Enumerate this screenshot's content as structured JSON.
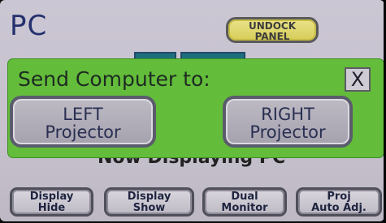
{
  "header": {
    "title": "PC",
    "undock_label": "UNDOCK\nPANEL"
  },
  "background": {
    "status_text": "Now Displaying PC"
  },
  "dialog": {
    "title": "Send Computer to:",
    "close_label": "X",
    "left_button": "LEFT\nProjector",
    "right_button": "RIGHT\nProjector",
    "accent_color": "#63bd3a"
  },
  "footer": {
    "buttons": [
      {
        "label": "Display\nHide"
      },
      {
        "label": "Display\nShow"
      },
      {
        "label": "Dual\nMonitor"
      },
      {
        "label": "Proj\nAuto Adj."
      }
    ]
  }
}
